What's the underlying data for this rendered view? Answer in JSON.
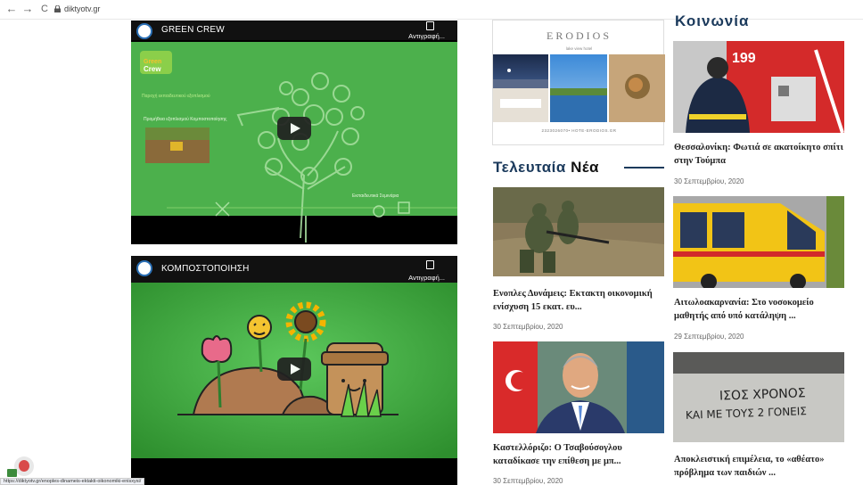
{
  "browser": {
    "back": "←",
    "forward": "→",
    "reload": "C",
    "url": "diktyotv.gr"
  },
  "videos": [
    {
      "title": "GREEN CREW",
      "copy": "Αντιγραφή...",
      "lines": [
        "Παροχή εκπαιδευτικού εξοπλισμού",
        "Προμήθεια εξοπλισμού Κομποστοποίησης",
        "Εκπαιδευτικά Σεμινάρια"
      ]
    },
    {
      "title": "ΚΟΜΠΟΣΤΟΠΟΙΗΣΗ",
      "copy": "Αντιγραφή..."
    }
  ],
  "ad": {
    "title": "ERODIOS",
    "subtitle": "lake view hotel",
    "footer": "2323026070• HOTE-ERODIOS.GR"
  },
  "latest": {
    "heading_a": "Τελευταία",
    "heading_b": "Νέα",
    "items": [
      {
        "title": "Ενοπλες Δυνάμεις: Εκτακτη οικονομική ενίσχυση 15 εκατ. ευ...",
        "date": "30 Σεπτεμβρίου, 2020"
      },
      {
        "title": "Καστελλόριζο: Ο Τσαβούσογλου καταδίκασε την επίθεση με μπ...",
        "date": "30 Σεπτεμβρίου, 2020"
      }
    ]
  },
  "society": {
    "heading": "Κοινωνία",
    "items": [
      {
        "title": "Θεσσαλονίκη: Φωτιά σε ακατοίκητο σπίτι στην Τούμπα",
        "date": "30 Σεπτεμβρίου, 2020"
      },
      {
        "title": "Αιτωλοακαρνανία: Στο νοσοκομείο μαθητής από υπό κατάληψη ...",
        "date": "29 Σεπτεμβρίου, 2020"
      },
      {
        "title": "Αποκλειστική επιμέλεια, το «αθέατο» πρόβλημα των παιδιών ...",
        "date": ""
      }
    ],
    "graffiti_line1": "ΙΣΟΣ ΧΡΟΝΟΣ",
    "graffiti_line2": "ΚΑΙ ΜΕ ΤΟΥΣ 2 ΓΟΝΕΙΣ",
    "truck_number": "199"
  },
  "statusbar": "https://diktyotv.gr/enoples-dinameis-ektakti-oikonomiki-enisxysi/",
  "colors": {
    "heading": "#1b3a5c",
    "video_green": "#4cb04c"
  }
}
